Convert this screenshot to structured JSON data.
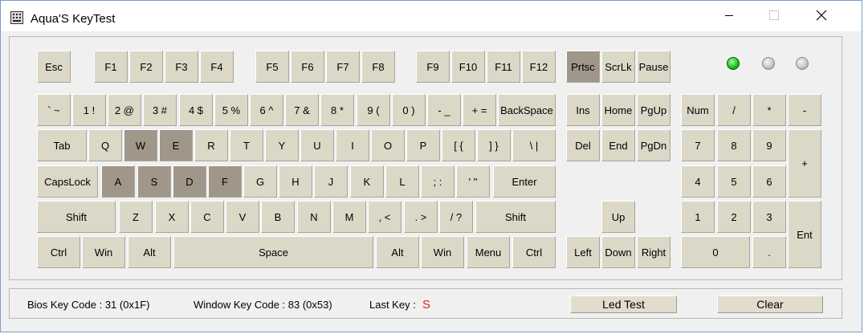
{
  "window": {
    "title": "Aqua'S KeyTest",
    "app_icon": "keyboard-grid-icon"
  },
  "caption_buttons": {
    "minimize_icon": "minimize-icon",
    "maximize_icon": "maximize-icon",
    "close_icon": "close-icon"
  },
  "colors": {
    "key_face": "#dcd8c8",
    "key_pressed": "#a0978a",
    "led_on": "#1fc41f",
    "led_off": "#c8c8c8",
    "last_key_value": "#e0201c"
  },
  "keyboard": {
    "function_row": {
      "esc": "Esc",
      "f1": "F1",
      "f2": "F2",
      "f3": "F3",
      "f4": "F4",
      "f5": "F5",
      "f6": "F6",
      "f7": "F7",
      "f8": "F8",
      "f9": "F9",
      "f10": "F10",
      "f11": "F11",
      "f12": "F12",
      "prtsc": "Prtsc",
      "scrlk": "ScrLk",
      "pause": "Pause"
    },
    "number_row": {
      "backquote": "` ~",
      "1": "1 !",
      "2": "2 @",
      "3": "3 #",
      "4": "4 $",
      "5": "5 %",
      "6": "6 ^",
      "7": "7 &",
      "8": "8 *",
      "9": "9 (",
      "0": "0 )",
      "minus": "- _",
      "equal": "+ =",
      "backspace": "BackSpace"
    },
    "qwerty_row": {
      "tab": "Tab",
      "q": "Q",
      "w": "W",
      "e": "E",
      "r": "R",
      "t": "T",
      "y": "Y",
      "u": "U",
      "i": "I",
      "o": "O",
      "p": "P",
      "lbracket": "[ {",
      "rbracket": "] }",
      "backslash": "\\ |"
    },
    "home_row": {
      "capslock": "CapsLock",
      "a": "A",
      "s": "S",
      "d": "D",
      "f": "F",
      "g": "G",
      "h": "H",
      "j": "J",
      "k": "K",
      "l": "L",
      "semicolon": "; :",
      "quote": "' \"",
      "enter": "Enter"
    },
    "shift_row": {
      "lshift": "Shift",
      "z": "Z",
      "x": "X",
      "c": "C",
      "v": "V",
      "b": "B",
      "n": "N",
      "m": "M",
      "comma": ", <",
      "period": ". >",
      "slash": "/ ?",
      "rshift": "Shift"
    },
    "bottom_row": {
      "lctrl": "Ctrl",
      "lwin": "Win",
      "lalt": "Alt",
      "space": "Space",
      "ralt": "Alt",
      "rwin": "Win",
      "menu": "Menu",
      "rctrl": "Ctrl"
    },
    "nav_cluster": {
      "ins": "Ins",
      "home": "Home",
      "pgup": "PgUp",
      "del": "Del",
      "end": "End",
      "pgdn": "PgDn",
      "up": "Up",
      "left": "Left",
      "down": "Down",
      "right": "Right"
    },
    "numpad": {
      "num": "Num",
      "divide": "/",
      "multiply": "*",
      "subtract": "-",
      "n7": "7",
      "n8": "8",
      "n9": "9",
      "add": "+",
      "n4": "4",
      "n5": "5",
      "n6": "6",
      "n1": "1",
      "n2": "2",
      "n3": "3",
      "enter": "Ent",
      "n0": "0",
      "decimal": "."
    },
    "pressed_keys": [
      "Prtsc",
      "W",
      "E",
      "A",
      "S",
      "D",
      "F"
    ],
    "leds": [
      {
        "name": "num-lock",
        "state": "on"
      },
      {
        "name": "caps-lock",
        "state": "off"
      },
      {
        "name": "scroll-lock",
        "state": "off"
      }
    ]
  },
  "status": {
    "bios_key_code": "Bios Key Code : 31 (0x1F)",
    "window_key_code": "Window Key Code : 83 (0x53)",
    "last_key_label": "Last Key :",
    "last_key_value": "S",
    "led_test_button": "Led Test",
    "clear_button": "Clear"
  }
}
